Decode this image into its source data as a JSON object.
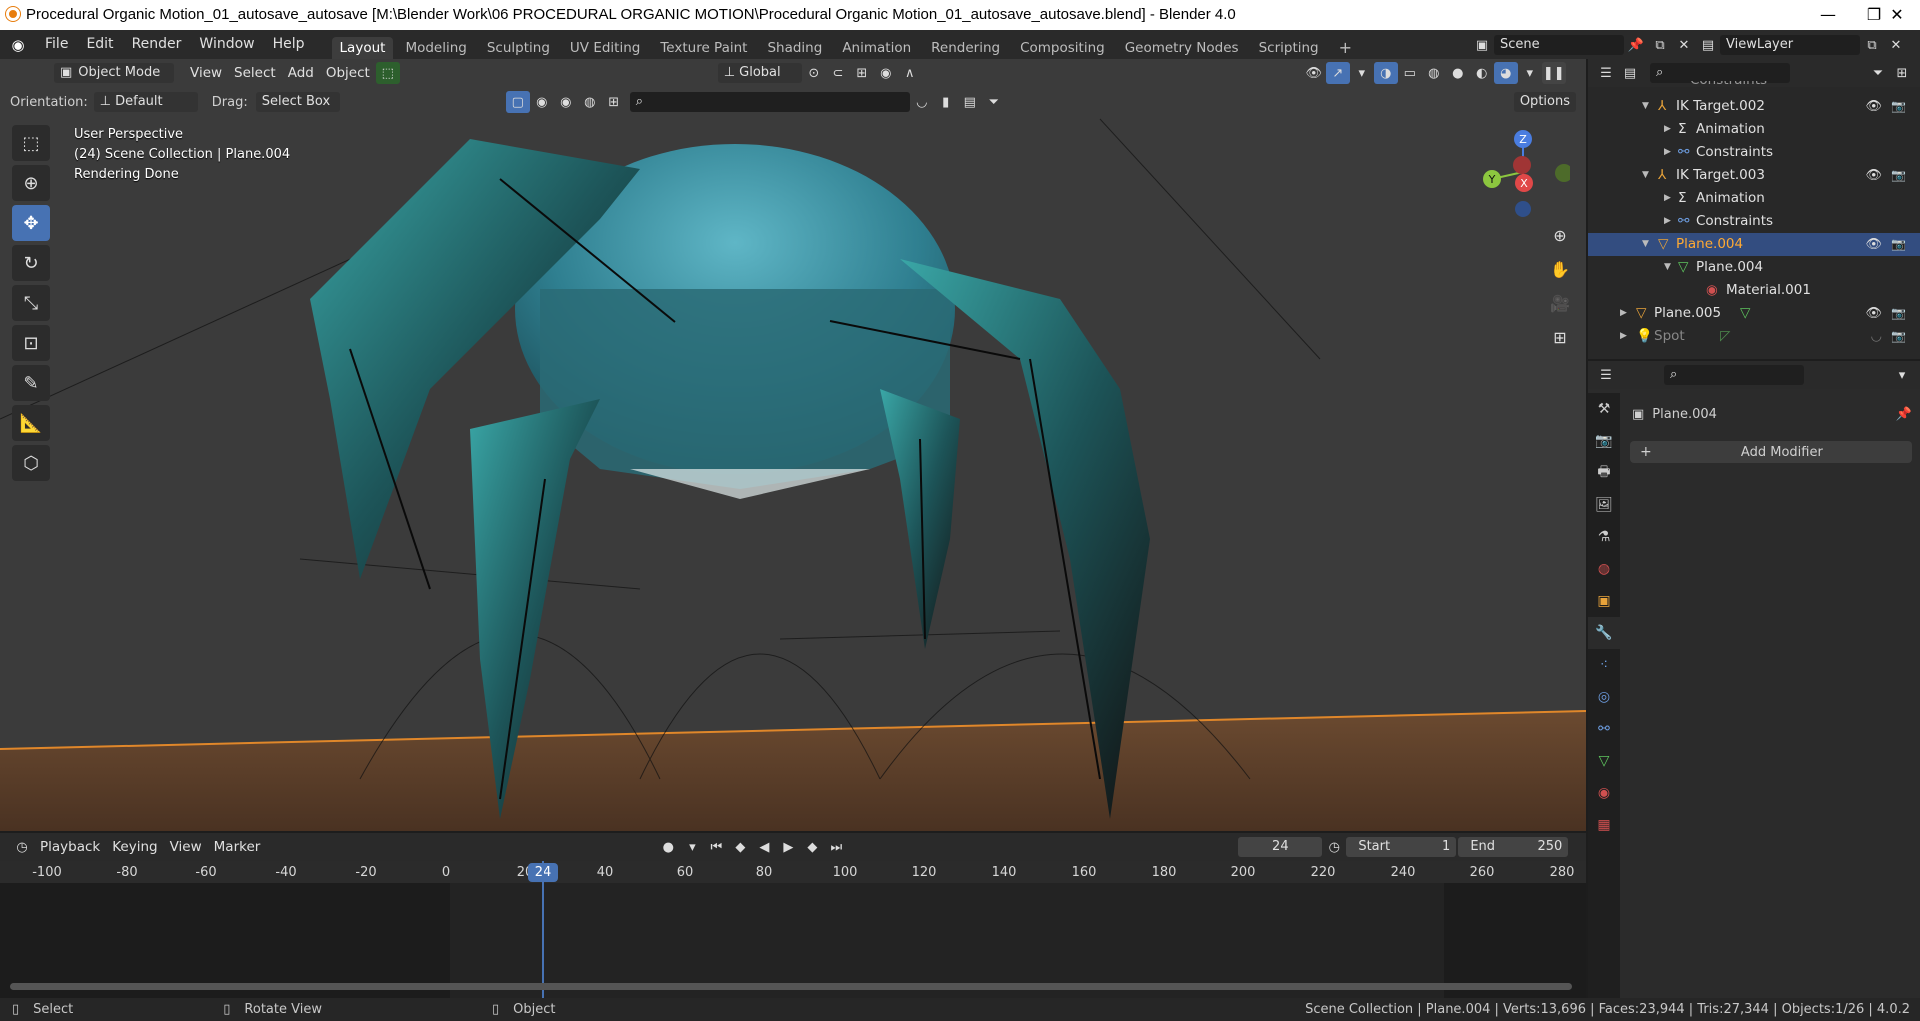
{
  "window": {
    "title": "Procedural Organic Motion_01_autosave_autosave [M:\\Blender Work\\06 PROCEDURAL ORGANIC MOTION\\Procedural Organic Motion_01_autosave_autosave.blend] - Blender 4.0",
    "minimize": "—",
    "maximize": "❐",
    "close": "✕"
  },
  "menu": [
    "File",
    "Edit",
    "Render",
    "Window",
    "Help"
  ],
  "workspaces": [
    "Layout",
    "Modeling",
    "Sculpting",
    "UV Editing",
    "Texture Paint",
    "Shading",
    "Animation",
    "Rendering",
    "Compositing",
    "Geometry Nodes",
    "Scripting"
  ],
  "scene": {
    "name": "Scene",
    "view_layer": "ViewLayer"
  },
  "viewport_header": {
    "mode": "Object Mode",
    "menus": [
      "View",
      "Select",
      "Add",
      "Object"
    ],
    "transform_orientation": "Global"
  },
  "tool_header": {
    "orientation_label": "Orientation:",
    "orientation_value": "Default",
    "drag_label": "Drag:",
    "drag_value": "Select Box",
    "options": "Options"
  },
  "overlay": {
    "line1": "User Perspective",
    "line2": "(24) Scene Collection | Plane.004",
    "line3": "Rendering Done"
  },
  "gizmo": {
    "x": "X",
    "y": "Y",
    "z": "Z"
  },
  "timeline": {
    "menus": [
      "Playback",
      "Keying",
      "View",
      "Marker"
    ],
    "current_frame": "24",
    "start_label": "Start",
    "start": "1",
    "end_label": "End",
    "end": "250",
    "ticks": [
      "-100",
      "-80",
      "-60",
      "-40",
      "-20",
      "0",
      "20",
      "40",
      "60",
      "80",
      "100",
      "120",
      "140",
      "160",
      "180",
      "200",
      "220",
      "240",
      "260",
      "280"
    ],
    "playhead": "24"
  },
  "status": {
    "left": [
      "Select",
      "Rotate View",
      "Object"
    ],
    "right": "Scene Collection | Plane.004 | Verts:13,696 | Faces:23,944 | Tris:27,344 | Objects:1/26 | 4.0.2"
  },
  "outliner": {
    "rows": [
      {
        "label": "Constraints",
        "indent": 3
      },
      {
        "label": "IK Target.002",
        "indent": 2
      },
      {
        "label": "Animation",
        "indent": 3
      },
      {
        "label": "Constraints",
        "indent": 3
      },
      {
        "label": "IK Target.003",
        "indent": 2
      },
      {
        "label": "Animation",
        "indent": 3
      },
      {
        "label": "Constraints",
        "indent": 3
      },
      {
        "label": "Plane.004",
        "indent": 2
      },
      {
        "label": "Plane.004",
        "indent": 3
      },
      {
        "label": "Material.001",
        "indent": 4
      },
      {
        "label": "Plane.005",
        "indent": 1
      },
      {
        "label": "Spot",
        "indent": 1
      }
    ]
  },
  "properties": {
    "object_name": "Plane.004",
    "add_modifier": "Add Modifier"
  },
  "colors": {
    "accent_blue": "#4772b3",
    "selected_orange": "#ffaa33",
    "playhead": "#4772b3"
  }
}
